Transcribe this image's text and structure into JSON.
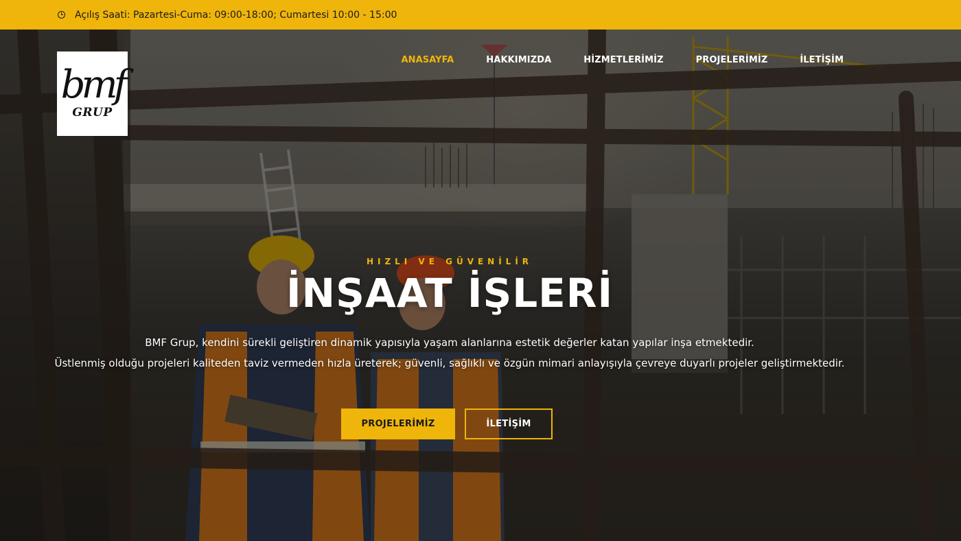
{
  "topbar": {
    "icon": "clock-icon",
    "hours_text": "Açılış Saati: Pazartesi-Cuma: 09:00-18:00; Cumartesi 10:00 - 15:00"
  },
  "logo": {
    "mark": "bmf",
    "sub": "GRUP"
  },
  "nav": {
    "items": [
      {
        "label": "ANASAYFA",
        "active": true
      },
      {
        "label": "HAKKIMIZDA",
        "active": false
      },
      {
        "label": "HİZMETLERİMİZ",
        "active": false
      },
      {
        "label": "PROJELERİMİZ",
        "active": false
      },
      {
        "label": "İLETİŞİM",
        "active": false
      }
    ]
  },
  "hero": {
    "tagline": "HIZLI VE GÜVENİLİR",
    "headline": "İNŞAAT İŞLERİ",
    "description_line1": "BMF Grup, kendini sürekli geliştiren dinamik yapısıyla yaşam alanlarına estetik değerler katan yapılar inşa etmektedir.",
    "description_line2": "Üstlenmiş olduğu projeleri kaliteden taviz vermeden hızla üreterek; güvenli, sağlıklı ve özgün mimari anlayışıyla çevreye duyarlı projeler geliştirmektedir.",
    "primary_button": "PROJELERİMİZ",
    "secondary_button": "İLETİŞİM"
  },
  "colors": {
    "accent": "#efb50a",
    "text_light": "#ffffff",
    "text_dark": "#1b1b1b"
  }
}
